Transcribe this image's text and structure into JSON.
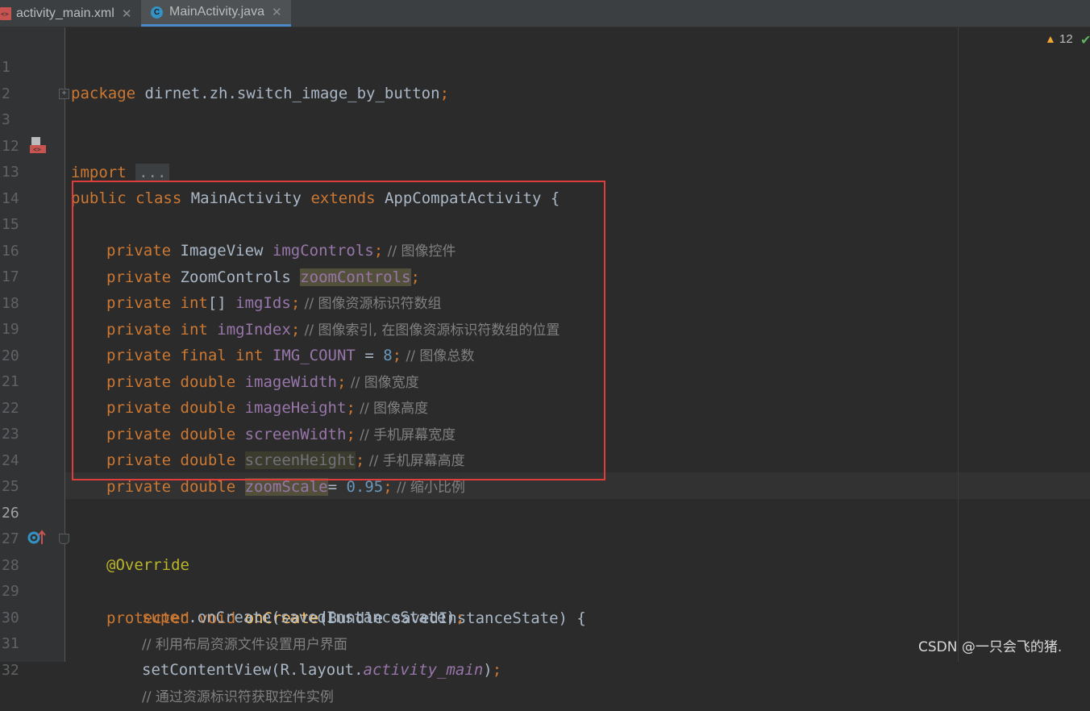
{
  "tabs": [
    {
      "label": "activity_main.xml",
      "icon": "xml-file-icon",
      "active": false
    },
    {
      "label": "MainActivity.java",
      "icon": "java-class-icon",
      "active": true
    }
  ],
  "inspections": {
    "warnings": "12"
  },
  "fold_placeholder": "...",
  "watermark": "CSDN @一只会飞的猪.",
  "colors": {
    "keyword": "#cc7832",
    "field": "#9876aa",
    "number": "#6897bb",
    "comment": "#808080",
    "annotation": "#bbb529",
    "method": "#ffc66d",
    "highlight_box": "#e03c3c"
  },
  "lines": {
    "l1": {
      "n": "1",
      "a": "package",
      "b": " dirnet.zh.switch_image_by_button",
      "c": ";"
    },
    "l2": {
      "n": "2"
    },
    "l3": {
      "n": "3",
      "a": "import",
      "b": " "
    },
    "l12": {
      "n": "12"
    },
    "l13": {
      "n": "13",
      "a": "public class",
      "b": " MainActivity ",
      "c": "extends",
      "d": " AppCompatActivity {"
    },
    "l14": {
      "n": "14"
    },
    "l15": {
      "n": "15",
      "a": "private",
      "b": " ImageView ",
      "f": "imgControls",
      "s": ";",
      "cm": " // 图像控件"
    },
    "l16": {
      "n": "16",
      "a": "private",
      "b": " ZoomControls ",
      "f": "zoomControls",
      "s": ";"
    },
    "l17": {
      "n": "17",
      "a": "private",
      "t": " int",
      "b": "[] ",
      "f": "imgIds",
      "s": ";",
      "cm": " // 图像资源标识符数组"
    },
    "l18": {
      "n": "18",
      "a": "private",
      "t": " int",
      "b": " ",
      "f": "imgIndex",
      "s": ";",
      "cm": " // 图像索引, 在图像资源标识符数组的位置"
    },
    "l19": {
      "n": "19",
      "a": "private",
      "t": " final int",
      "b": " ",
      "f": "IMG_COUNT",
      "eq": " = ",
      "v": "8",
      "s": ";",
      "cm": " // 图像总数"
    },
    "l20": {
      "n": "20",
      "a": "private",
      "t": " double",
      "b": " ",
      "f": "imageWidth",
      "s": ";",
      "cm": " // 图像宽度"
    },
    "l21": {
      "n": "21",
      "a": "private",
      "t": " double",
      "b": " ",
      "f": "imageHeight",
      "s": ";",
      "cm": " // 图像高度"
    },
    "l22": {
      "n": "22",
      "a": "private",
      "t": " double",
      "b": " ",
      "f": "screenWidth",
      "s": ";",
      "cm": " // 手机屏幕宽度"
    },
    "l23": {
      "n": "23",
      "a": "private",
      "t": " double",
      "b": " ",
      "f": "screenHeight",
      "s": ";",
      "cm": " // 手机屏幕高度"
    },
    "l24": {
      "n": "24",
      "a": "private",
      "t": " double",
      "b": " ",
      "f": "zoomScale",
      "eq": "= ",
      "v": "0.95",
      "s": ";",
      "cm": " // 缩小比例"
    },
    "l25": {
      "n": "25"
    },
    "l26": {
      "n": "26"
    },
    "l27": {
      "n": "27",
      "a": "@Override"
    },
    "l28": {
      "n": "28",
      "a": "protected void",
      "b": " ",
      "fn": "onCreate",
      "c": "(Bundle savedInstanceState) {"
    },
    "l29": {
      "n": "29",
      "a": "super",
      "b": ".onCreate(savedInstanceState)",
      "s": ";"
    },
    "l30": {
      "n": "30",
      "cm": "// 利用布局资源文件设置用户界面"
    },
    "l31": {
      "n": "31",
      "b": "setContentView(R.layout.",
      "it": "activity_main",
      "c": ")",
      "s": ";"
    },
    "l32": {
      "n": "32",
      "cm": "// 通过资源标识符获取控件实例"
    }
  }
}
